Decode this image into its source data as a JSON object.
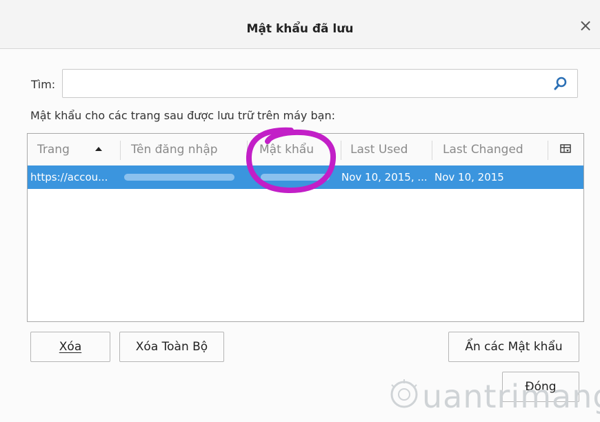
{
  "window": {
    "title": "Mật khẩu đã lưu",
    "close_glyph": "×"
  },
  "search": {
    "label": "Tìm:",
    "value": "",
    "placeholder": ""
  },
  "description": "Mật khẩu cho các trang sau được lưu trữ trên máy bạn:",
  "table": {
    "columns": [
      "Trang",
      "Tên đăng nhập",
      "Mật khẩu",
      "Last Used",
      "Last Changed"
    ],
    "sorted_column": "Trang",
    "rows": [
      {
        "site": "https://accou...",
        "username": "",
        "password": "",
        "last_used": "Nov 10, 2015, ...",
        "last_changed": "Nov 10, 2015",
        "selected": true
      }
    ]
  },
  "buttons": {
    "remove": "Xóa",
    "remove_all": "Xóa Toàn Bộ",
    "toggle_passwords": "Ẩn các Mật khẩu",
    "close": "Đóng"
  },
  "watermark": {
    "text": "uantrimang"
  },
  "colors": {
    "selection": "#3b95de",
    "annotation": "#c21fc7",
    "title_bg": "#f4f4f4"
  }
}
